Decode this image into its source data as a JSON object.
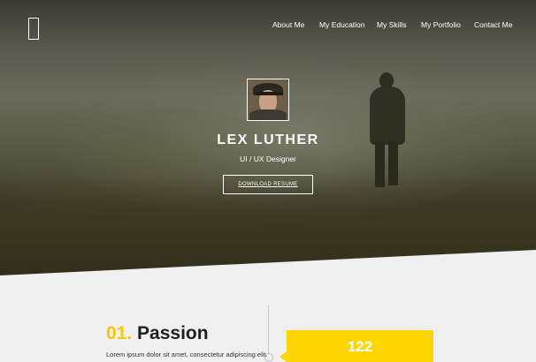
{
  "nav": {
    "items": [
      {
        "label": "About Me"
      },
      {
        "label": "My Education"
      },
      {
        "label": "My Skills"
      },
      {
        "label": "My Portfolio"
      },
      {
        "label": "Contact Me"
      }
    ]
  },
  "hero": {
    "name": "LEX LUTHER",
    "role": "UI / UX Designer",
    "download_label": "DOWNLOAD RESUME"
  },
  "section": {
    "number": "01.",
    "title": "Passion",
    "text": "Lorem ipsum dolor sit amet, consectetur adipiscing elit.",
    "card_value": "122"
  },
  "colors": {
    "accent": "#ffd600",
    "number_accent": "#f7c800",
    "page_bg": "#f0f0f0"
  },
  "icons": {
    "logo": "bracket-logo",
    "timeline": "timeline-dot"
  }
}
